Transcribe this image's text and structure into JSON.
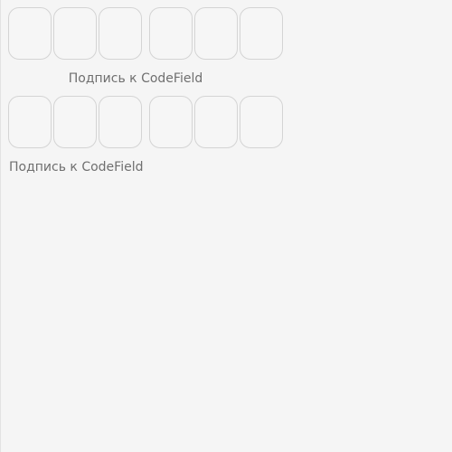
{
  "codefields": [
    {
      "cells": [
        "",
        "",
        "",
        "",
        "",
        ""
      ],
      "caption": "Подпись к CodeField",
      "caption_align": "center"
    },
    {
      "cells": [
        "",
        "",
        "",
        "",
        "",
        ""
      ],
      "caption": "Подпись к CodeField",
      "caption_align": "left"
    }
  ],
  "colors": {
    "background": "#f5f5f5",
    "cell_border": "#d4d4d4",
    "caption_text": "#6f6f6f"
  }
}
